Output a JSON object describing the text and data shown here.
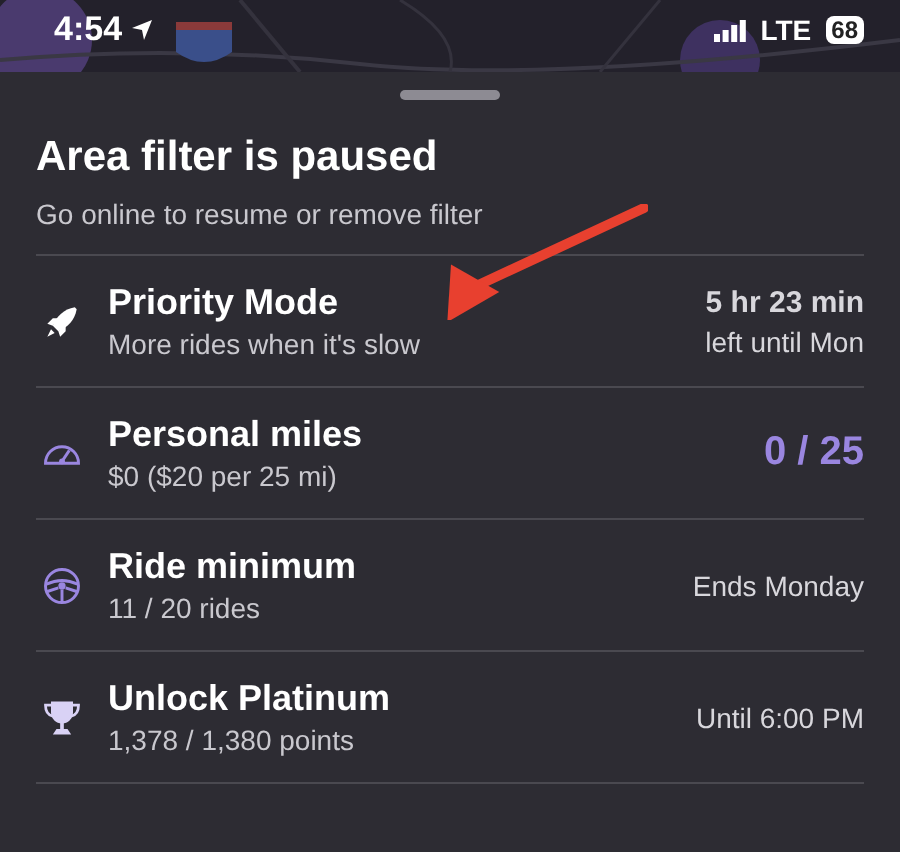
{
  "status_bar": {
    "time": "4:54",
    "network": "LTE",
    "battery": "68"
  },
  "sheet": {
    "title": "Area filter is paused",
    "subtitle": "Go online to resume or remove filter"
  },
  "rows": [
    {
      "kind": "timer",
      "title": "Priority Mode",
      "subtitle": "More rides when it's slow",
      "value": [
        "5 hr 23 min",
        "left until Mon"
      ]
    },
    {
      "kind": "counter",
      "title": "Personal miles",
      "subtitle": "$0 ($20 per 25 mi)",
      "value": [
        "0 / 25"
      ]
    },
    {
      "kind": "status",
      "title": "Ride minimum",
      "subtitle": "11 / 20 rides",
      "value": [
        "Ends Monday"
      ]
    },
    {
      "kind": "status",
      "title": "Unlock Platinum",
      "subtitle": "1,378 / 1,380 points",
      "value": [
        "Until 6:00 PM"
      ]
    }
  ],
  "annotation": {
    "kind": "arrow"
  }
}
